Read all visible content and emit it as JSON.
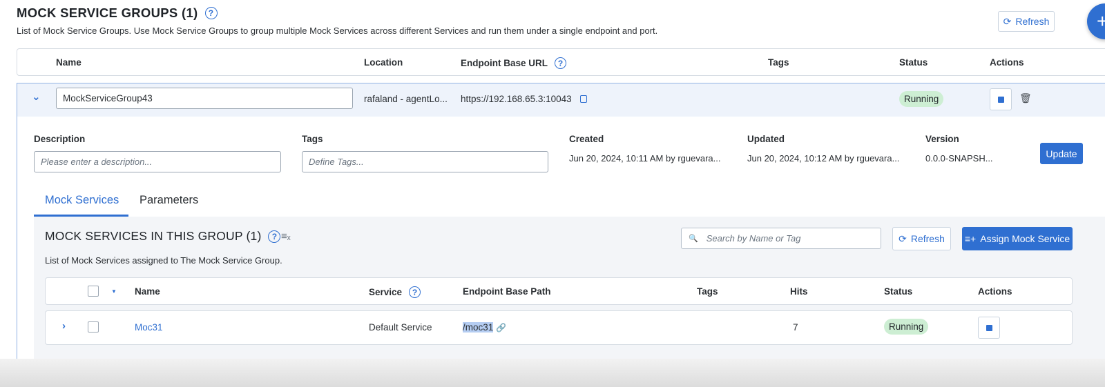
{
  "page": {
    "title": "MOCK SERVICE GROUPS (1)",
    "subtitle": "List of Mock Service Groups. Use Mock Service Groups to group multiple Mock Services across different Services and run them under a single endpoint and port.",
    "refresh_label": "Refresh",
    "add_icon": "+"
  },
  "table": {
    "columns": [
      "Name",
      "Location",
      "Endpoint Base URL",
      "Tags",
      "Status",
      "Actions"
    ]
  },
  "group": {
    "name": "MockServiceGroup43",
    "location": "rafaland - agentLo...",
    "endpoint_url": "https://192.168.65.3:10043",
    "status": "Running",
    "details": {
      "description_label": "Description",
      "description_placeholder": "Please enter a description...",
      "tags_label": "Tags",
      "tags_placeholder": "Define Tags...",
      "created_label": "Created",
      "created_value": "Jun 20, 2024, 10:11 AM by rguevara...",
      "updated_label": "Updated",
      "updated_value": "Jun 20, 2024, 10:12 AM by rguevara...",
      "version_label": "Version",
      "version_value": "0.0.0-SNAPSH...",
      "update_label": "Update"
    },
    "tabs": [
      "Mock Services",
      "Parameters"
    ]
  },
  "mock_services": {
    "title": "MOCK SERVICES IN THIS GROUP (1)",
    "subtitle": "List of Mock Services assigned to The Mock Service Group.",
    "search_placeholder": "Search by Name or Tag",
    "refresh_label": "Refresh",
    "assign_label": "Assign Mock Service",
    "columns": [
      "Name",
      "Service",
      "Endpoint Base Path",
      "Tags",
      "Hits",
      "Status",
      "Actions"
    ],
    "rows": [
      {
        "name": "Moc31",
        "service": "Default Service",
        "path": "/moc31",
        "tags": "",
        "hits": "7",
        "status": "Running"
      }
    ]
  },
  "colors": {
    "accent": "#2f6fd1",
    "running_badge": "#cdeed3",
    "panel_bg": "#eef3fb"
  }
}
